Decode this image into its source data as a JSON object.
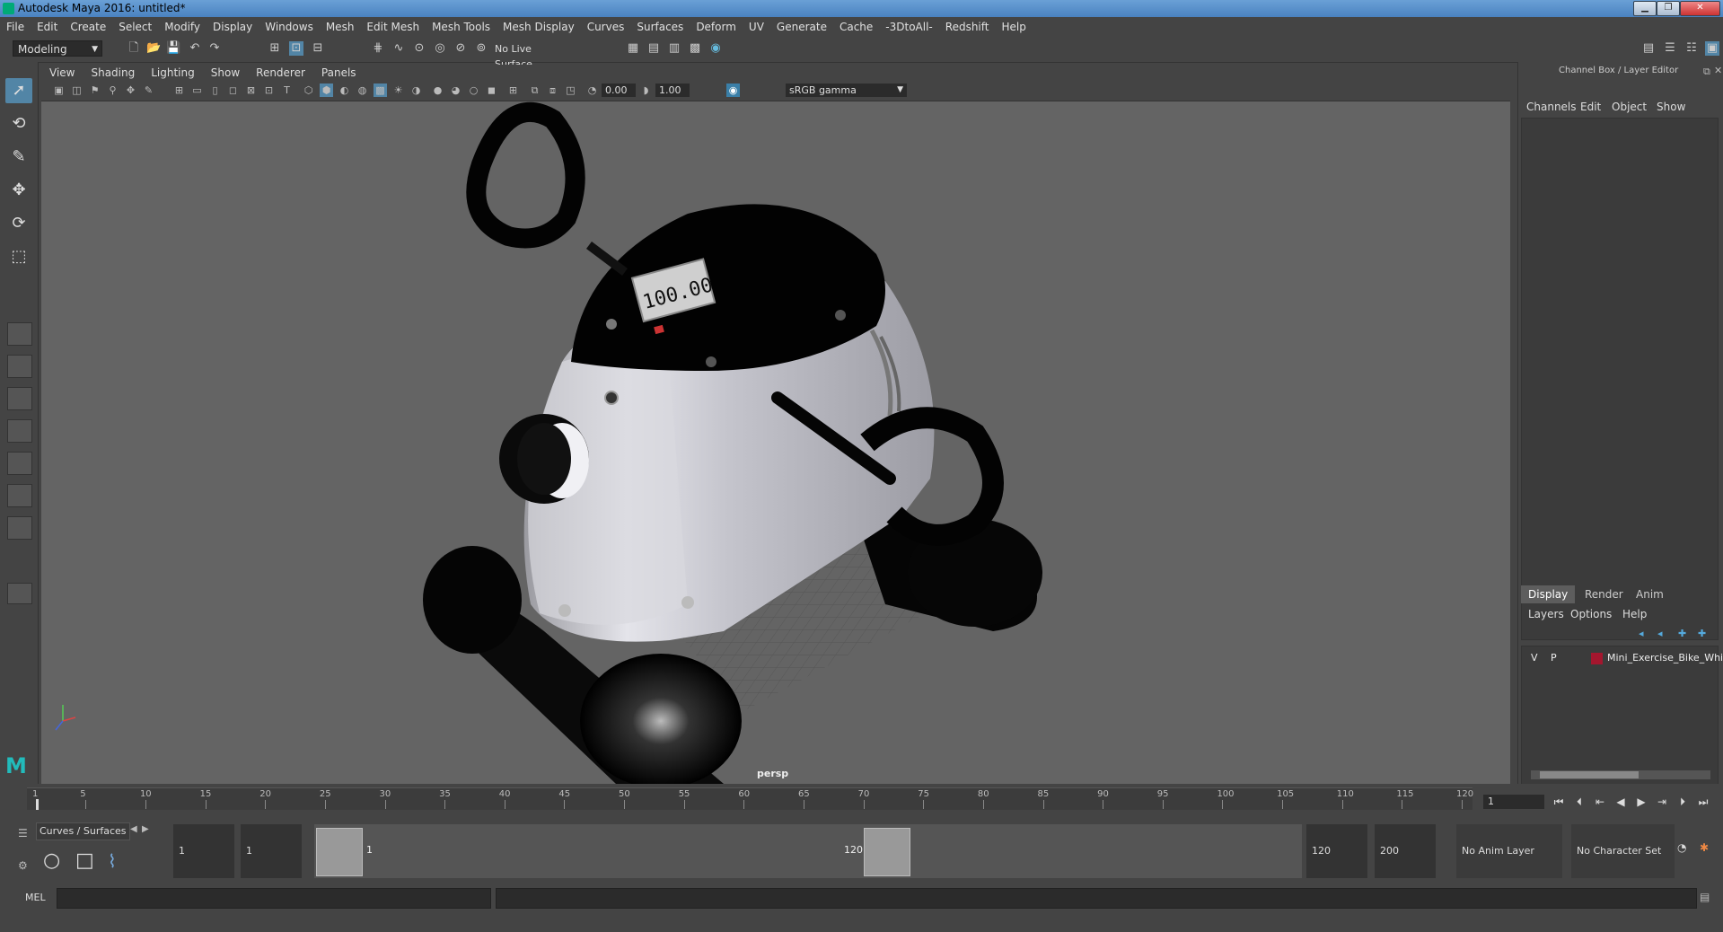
{
  "window": {
    "title": "Autodesk Maya 2016: untitled*"
  },
  "menubar": [
    "File",
    "Edit",
    "Create",
    "Select",
    "Modify",
    "Display",
    "Windows",
    "Mesh",
    "Edit Mesh",
    "Mesh Tools",
    "Mesh Display",
    "Curves",
    "Surfaces",
    "Deform",
    "UV",
    "Generate",
    "Cache",
    "-3DtoAll-",
    "Redshift",
    "Help"
  ],
  "statusline": {
    "mode": "Modeling",
    "live_surface": "No Live Surface"
  },
  "panel": {
    "menu": [
      "View",
      "Shading",
      "Lighting",
      "Show",
      "Renderer",
      "Panels"
    ],
    "exposure": "0.00",
    "gamma": "1.00",
    "color_space": "sRGB gamma",
    "camera": "persp"
  },
  "scene": {
    "screen_text": "100.00"
  },
  "channelbox": {
    "title": "Channel Box / Layer Editor",
    "menu": [
      "Channels",
      "Edit",
      "Object",
      "Show"
    ]
  },
  "layer_editor": {
    "tabs": [
      "Display",
      "Render",
      "Anim"
    ],
    "menu": [
      "Layers",
      "Options",
      "Help"
    ],
    "layer": {
      "v": "V",
      "p": "P",
      "name": "Mini_Exercise_Bike_Whit",
      "color": "#a4162e"
    }
  },
  "timeslider": {
    "ticks": [
      "1",
      "5",
      "10",
      "15",
      "20",
      "25",
      "30",
      "35",
      "40",
      "45",
      "50",
      "55",
      "60",
      "65",
      "70",
      "75",
      "80",
      "85",
      "90",
      "95",
      "100",
      "105",
      "110",
      "115",
      "120"
    ],
    "current_frame": "1"
  },
  "rangeslider": {
    "shelf_tab": "Curves / Surfaces",
    "start": "1",
    "playback_start": "1",
    "range_start_label": "1",
    "range_end_label": "120",
    "playback_end": "120",
    "end": "200",
    "anim_layer": "No Anim Layer",
    "character_set": "No Character Set"
  },
  "cmdline": {
    "label": "MEL"
  }
}
